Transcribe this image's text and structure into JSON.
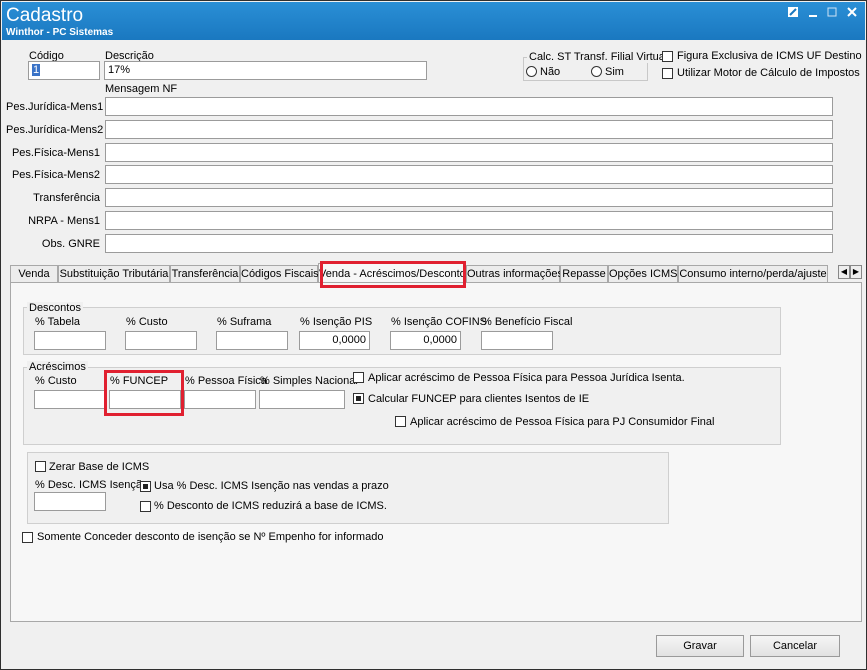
{
  "window": {
    "title": "Cadastro",
    "subtitle": "Winthor - PC Sistemas",
    "controls": [
      "restore-icon",
      "minimize-icon",
      "maximize-icon",
      "close-icon"
    ]
  },
  "header": {
    "codigo_label": "Código",
    "codigo_value": "1",
    "descricao_label": "Descrição",
    "descricao_value": "17%",
    "mensagem_label": "Mensagem NF",
    "calc_st_label": "Calc. ST Transf. Filial Virtual",
    "radio_nao": "Não",
    "radio_sim": "Sim",
    "check_figura": "Figura Exclusiva de ICMS UF Destino",
    "check_motor": "Utilizar Motor de Cálculo de Impostos"
  },
  "messages": [
    {
      "label": "Pes.Jurídica-Mens1",
      "value": ""
    },
    {
      "label": "Pes.Jurídica-Mens2",
      "value": ""
    },
    {
      "label": "Pes.Física-Mens1",
      "value": ""
    },
    {
      "label": "Pes.Física-Mens2",
      "value": ""
    },
    {
      "label": "Transferência",
      "value": ""
    },
    {
      "label": "NRPA - Mens1",
      "value": ""
    },
    {
      "label": "Obs. GNRE",
      "value": ""
    }
  ],
  "tabs": [
    "Venda",
    "Substituição Tributária",
    "Transferência",
    "Códigos Fiscais",
    "Venda - Acréscimos/Descontos",
    "Outras informações",
    "Repasse",
    "Opções ICMS",
    "Consumo interno/perda/ajuste"
  ],
  "active_tab": "Venda - Acréscimos/Descontos",
  "descontos": {
    "title": "Descontos",
    "fields": [
      {
        "label": "% Tabela",
        "value": ""
      },
      {
        "label": "% Custo",
        "value": ""
      },
      {
        "label": "% Suframa",
        "value": ""
      },
      {
        "label": "% Isenção PIS",
        "value": "0,0000"
      },
      {
        "label": "% Isenção COFINS",
        "value": "0,0000"
      },
      {
        "label": "% Benefício Fiscal",
        "value": ""
      }
    ]
  },
  "acrescimos": {
    "title": "Acréscimos",
    "fields": [
      {
        "label": "% Custo",
        "value": ""
      },
      {
        "label": "% FUNCEP",
        "value": ""
      },
      {
        "label": "% Pessoa Física",
        "value": ""
      },
      {
        "label": "% Simples Nacional",
        "value": ""
      }
    ],
    "check_aplicar_pf_pj": "Aplicar acréscimo de Pessoa Física para Pessoa Jurídica Isenta.",
    "check_calcular_funcep": "Calcular FUNCEP para clientes Isentos de IE",
    "check_aplicar_pf_consumidor": "Aplicar acréscimo de Pessoa Física para PJ Consumidor Final"
  },
  "icms": {
    "check_zerar": "Zerar Base de ICMS",
    "desc_label": "% Desc. ICMS Isenção",
    "desc_value": "",
    "check_usa_desc": "Usa % Desc. ICMS Isenção nas vendas a prazo",
    "check_reduzira": "% Desconto de ICMS reduzirá a base de ICMS."
  },
  "check_somente": "Somente Conceder desconto de isenção se Nº Empenho for informado",
  "buttons": {
    "gravar": "Gravar",
    "cancelar": "Cancelar"
  },
  "colors": {
    "titlebar": "#1e82c8",
    "highlight": "#e02030"
  }
}
